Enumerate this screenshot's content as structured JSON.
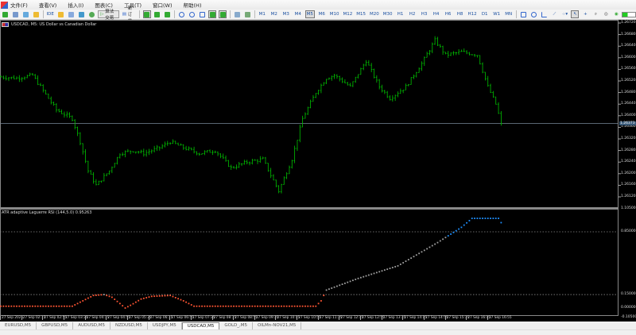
{
  "menu": [
    "文件(F)",
    "查看(V)",
    "插入(I)",
    "图表(C)",
    "工具(T)",
    "窗口(W)",
    "帮助(H)"
  ],
  "toolbar": {
    "ide": "IDE",
    "algo_trading": "算法交易",
    "new_order": "新订单",
    "timeframes": [
      "M1",
      "M2",
      "M3",
      "M4",
      "M5",
      "M6",
      "M10",
      "M12",
      "M15",
      "M20",
      "M30",
      "H1",
      "H2",
      "H3",
      "H4",
      "H6",
      "H8",
      "H12",
      "D1",
      "W1",
      "MN"
    ],
    "active_timeframe": "M5"
  },
  "chart": {
    "title": "USDCAD, M5:  US Dollar vs Canadian Dollar",
    "current_price": "1.26373",
    "price_labels": [
      "1.26720",
      "1.26680",
      "1.26640",
      "1.26600",
      "1.26560",
      "1.26520",
      "1.26480",
      "1.26440",
      "1.26400",
      "1.26360",
      "1.26320",
      "1.26280",
      "1.26240",
      "1.26200",
      "1.26160",
      "1.26120"
    ],
    "time_labels": [
      "27 Sep 2021",
      "27 Sep 02:15",
      "27 Sep 02:55",
      "27 Sep 03:35",
      "27 Sep 04:15",
      "27 Sep 04:55",
      "27 Sep 05:35",
      "27 Sep 06:15",
      "27 Sep 06:55",
      "27 Sep 07:35",
      "27 Sep 08:15",
      "27 Sep 08:55",
      "27 Sep 09:35",
      "27 Sep 10:15",
      "27 Sep 10:55",
      "27 Sep 11:35",
      "27 Sep 12:15",
      "27 Sep 12:55",
      "27 Sep 13:35",
      "27 Sep 14:15",
      "27 Sep 14:55",
      "27 Sep 15:35",
      "27 Sep 16:15",
      "27 Sep 16:55"
    ],
    "bar_color": "#00c000"
  },
  "chart_data": [
    {
      "type": "ohlc",
      "symbol": "USDCAD",
      "timeframe": "M5",
      "ylim": [
        1.261,
        1.2673
      ],
      "close_keypoints": [
        [
          "01:35",
          1.26534
        ],
        [
          "02:05",
          1.2653
        ],
        [
          "02:35",
          1.2654
        ],
        [
          "02:50",
          1.265
        ],
        [
          "03:20",
          1.2642
        ],
        [
          "03:50",
          1.2639
        ],
        [
          "04:05",
          1.2631
        ],
        [
          "04:20",
          1.2621
        ],
        [
          "04:35",
          1.2616
        ],
        [
          "05:00",
          1.2621
        ],
        [
          "05:20",
          1.2627
        ],
        [
          "05:45",
          1.2628
        ],
        [
          "06:05",
          1.2627
        ],
        [
          "06:35",
          1.2629
        ],
        [
          "06:55",
          1.2631
        ],
        [
          "07:20",
          1.2629
        ],
        [
          "07:50",
          1.2627
        ],
        [
          "08:20",
          1.2628
        ],
        [
          "08:50",
          1.2622
        ],
        [
          "09:20",
          1.2624
        ],
        [
          "09:50",
          1.2625
        ],
        [
          "10:20",
          1.2614
        ],
        [
          "10:45",
          1.2625
        ],
        [
          "11:05",
          1.2639
        ],
        [
          "11:30",
          1.2648
        ],
        [
          "11:50",
          1.2653
        ],
        [
          "12:05",
          1.2654
        ],
        [
          "12:35",
          1.265
        ],
        [
          "13:05",
          1.2659
        ],
        [
          "13:30",
          1.265
        ],
        [
          "13:50",
          1.2646
        ],
        [
          "14:20",
          1.265
        ],
        [
          "14:50",
          1.2658
        ],
        [
          "15:15",
          1.2666
        ],
        [
          "15:35",
          1.2661
        ],
        [
          "16:05",
          1.2662
        ],
        [
          "16:35",
          1.2661
        ],
        [
          "16:55",
          1.265
        ],
        [
          "17:10",
          1.2644
        ],
        [
          "17:20",
          1.26373
        ]
      ]
    },
    {
      "type": "scatter",
      "title": "ATR adaptive Laguerre RSI (144,5.0) 0.95263",
      "ylim": [
        -0.105,
        1.105
      ],
      "axis_labels": [
        "1.105000",
        "0.850000",
        "0.150000",
        "0.000000",
        "-0.105000"
      ],
      "levels": [
        0.85,
        0.15
      ],
      "colors": {
        "low": "#ff5533",
        "mid": "#a0a0a0",
        "high": "#1e90ff"
      },
      "keypoints": [
        [
          "01:35",
          0.02
        ],
        [
          "03:50",
          0.02
        ],
        [
          "04:10",
          0.08
        ],
        [
          "04:30",
          0.14
        ],
        [
          "04:50",
          0.15
        ],
        [
          "05:05",
          0.12
        ],
        [
          "05:20",
          0.05
        ],
        [
          "05:30",
          0.0
        ],
        [
          "05:40",
          0.03
        ],
        [
          "06:00",
          0.1
        ],
        [
          "06:20",
          0.13
        ],
        [
          "06:55",
          0.14
        ],
        [
          "07:20",
          0.08
        ],
        [
          "07:40",
          0.02
        ],
        [
          "11:30",
          0.02
        ],
        [
          "11:40",
          0.08
        ],
        [
          "11:50",
          0.2
        ],
        [
          "12:50",
          0.33
        ],
        [
          "14:05",
          0.47
        ],
        [
          "15:20",
          0.73
        ],
        [
          "16:05",
          0.9
        ],
        [
          "16:25",
          1.0
        ],
        [
          "17:15",
          1.0
        ],
        [
          "17:20",
          0.95263
        ]
      ]
    }
  ],
  "tabs": [
    "EURUSD,M5",
    "GBPUSD,M5",
    "AUDUSD,M5",
    "NZDUSD,M5",
    "USDJPY,M5",
    "USDCAD,M5",
    "GOLD_,M5",
    "OILMn-NOV21,M5"
  ],
  "active_tab": "USDCAD,M5"
}
